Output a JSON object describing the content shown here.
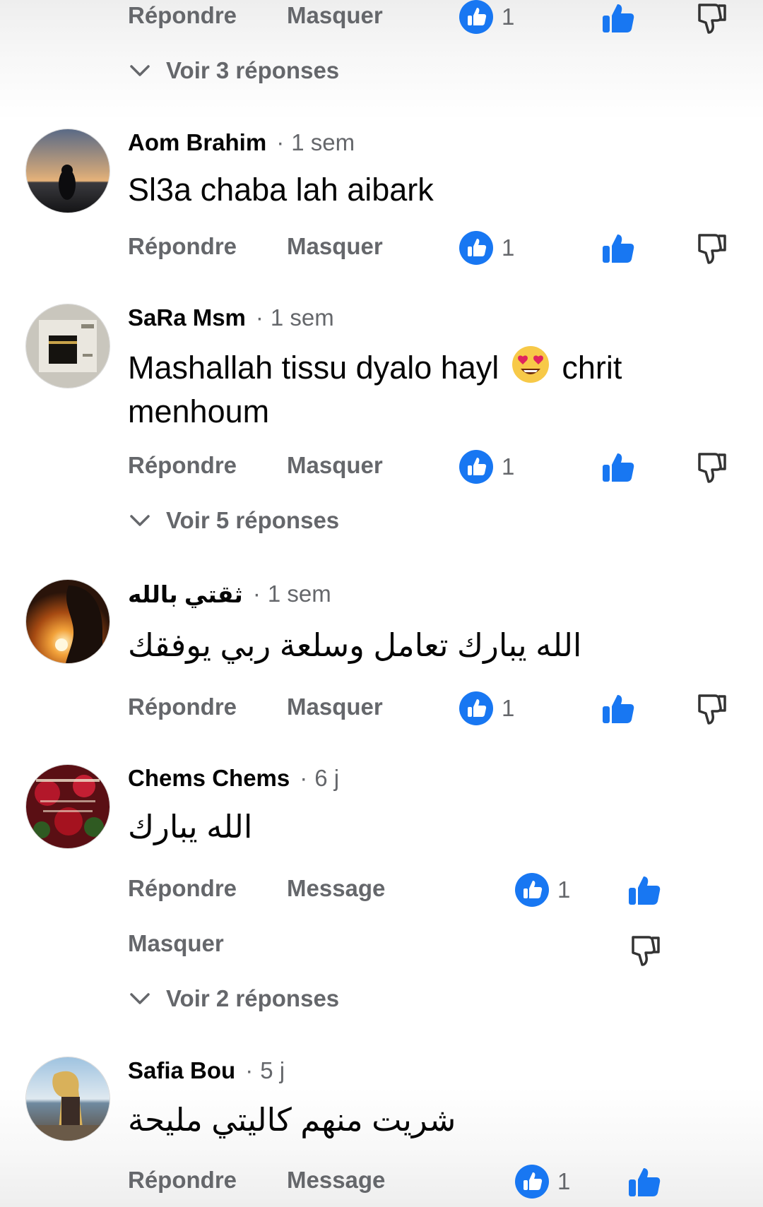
{
  "labels": {
    "reply": "Répondre",
    "hide": "Masquer",
    "message": "Message"
  },
  "colors": {
    "facebook_blue": "#1877f2",
    "secondary_text": "#65676b",
    "primary_text": "#050505"
  },
  "top_partial": {
    "reaction_count": "1",
    "view_replies": "Voir 3 réponses"
  },
  "comments": [
    {
      "author": "Aom Brahim",
      "time": "1 sem",
      "text": "Sl3a chaba lah aibark",
      "reaction_count": "1",
      "avatar_icon": "sunset-silhouette-avatar"
    },
    {
      "author": "SaRa Msm",
      "time": "1 sem",
      "text_before": "Mashallah tissu dyalo hayl",
      "emoji": "heart-eyes-emoji",
      "text_after": "chrit",
      "text_line2": "menhoum",
      "reaction_count": "1",
      "view_replies": "Voir 5 réponses",
      "avatar_icon": "kaaba-avatar"
    },
    {
      "author": "ثقتي بالله",
      "time": "1 sem",
      "text": "الله يبارك تعامل وسلعة ربي يوفقك",
      "reaction_count": "1",
      "avatar_icon": "veiled-woman-avatar"
    },
    {
      "author": "Chems Chems",
      "time": "6 j",
      "text": "الله يبارك",
      "reaction_count": "1",
      "view_replies": "Voir 2 réponses",
      "avatar_icon": "roses-avatar"
    },
    {
      "author": "Safia Bou",
      "time": "5 j",
      "text": "شريت منهم كاليتي مليحة",
      "reaction_count": "1",
      "avatar_icon": "seaside-woman-avatar"
    }
  ]
}
